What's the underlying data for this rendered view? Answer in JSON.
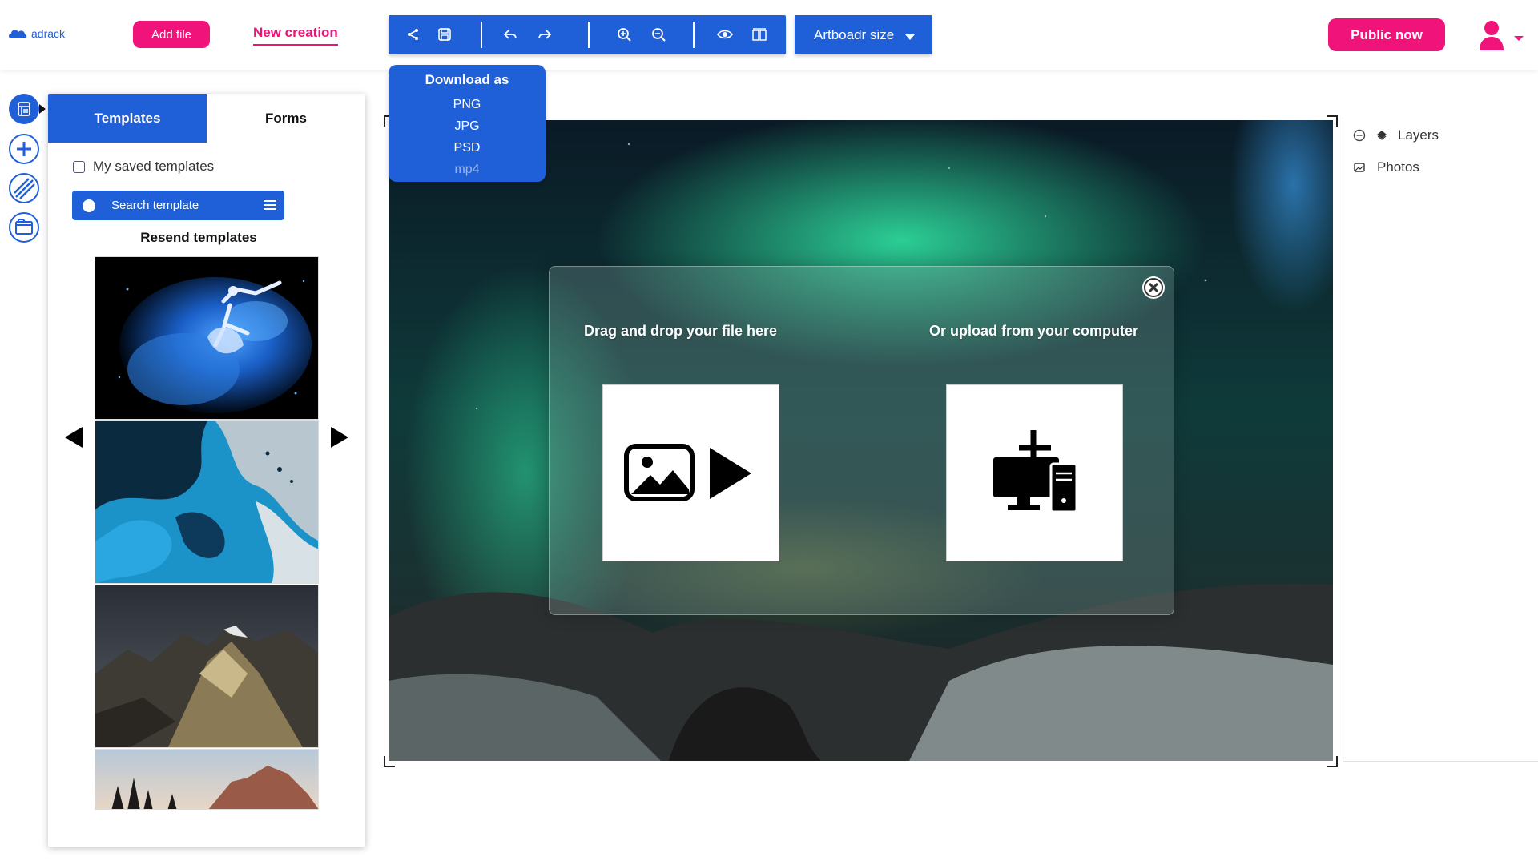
{
  "header": {
    "logo_text": "adrack",
    "add_file_label": "Add file",
    "new_creation_label": "New creation",
    "toolbar_icons": [
      "share-icon",
      "save-icon",
      "undo-icon",
      "redo-icon",
      "zoom-in-icon",
      "zoom-out-icon",
      "preview-icon",
      "compare-icon"
    ],
    "artboard_label": "Artboadr size",
    "public_label": "Public now"
  },
  "download_menu": {
    "title": "Download as",
    "options": [
      "PNG",
      "JPG",
      "PSD",
      "mp4"
    ]
  },
  "left_rail": {
    "icons": [
      "templates-icon",
      "add-icon",
      "pattern-icon",
      "folder-icon"
    ]
  },
  "panel": {
    "tabs": [
      "Templates",
      "Forms"
    ],
    "saved_label": "My saved templates",
    "search_placeholder": "Search template",
    "resend_title": "Resend templates"
  },
  "upload_modal": {
    "drag_label": "Drag and drop your file here",
    "upload_label": "Or upload from your computer"
  },
  "right_panel": {
    "items": [
      "Layers",
      "Photos"
    ]
  },
  "colors": {
    "primary_blue": "#1f5fd8",
    "accent_pink": "#f0147a"
  }
}
